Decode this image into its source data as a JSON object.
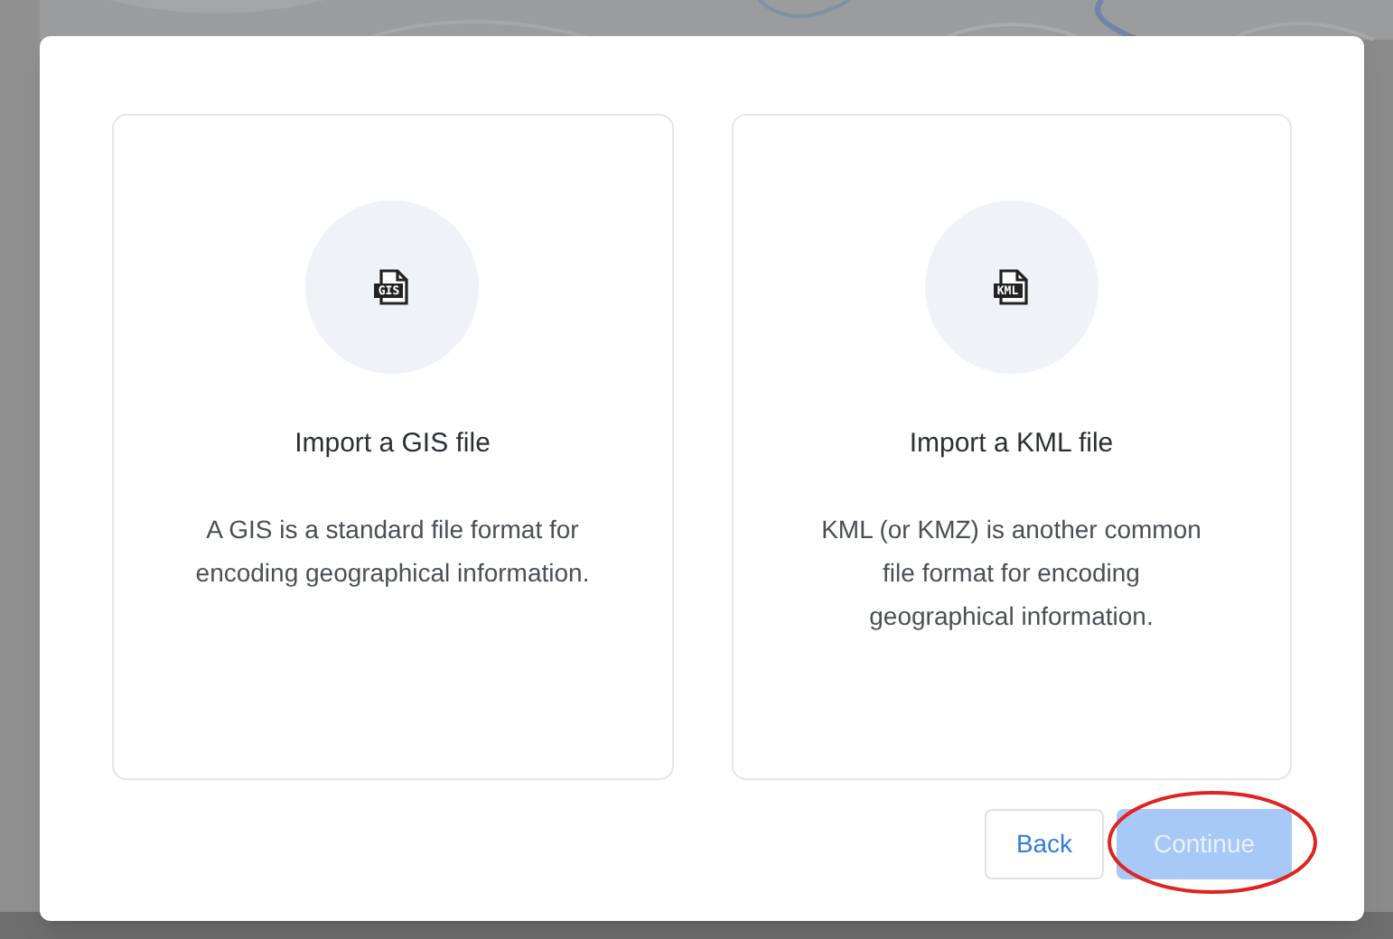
{
  "options": [
    {
      "icon_label": "GIS",
      "title": "Import a GIS file",
      "description": "A GIS is a standard file format for encoding geographical information."
    },
    {
      "icon_label": "KML",
      "title": "Import a KML file",
      "description": "KML (or KMZ) is another common file format for encoding geographical information."
    }
  ],
  "buttons": [
    {
      "kind": "secondary",
      "label": "Back",
      "disabled": false,
      "circled": false
    },
    {
      "kind": "primary",
      "label": "Continue",
      "disabled": true,
      "circled": true
    }
  ]
}
